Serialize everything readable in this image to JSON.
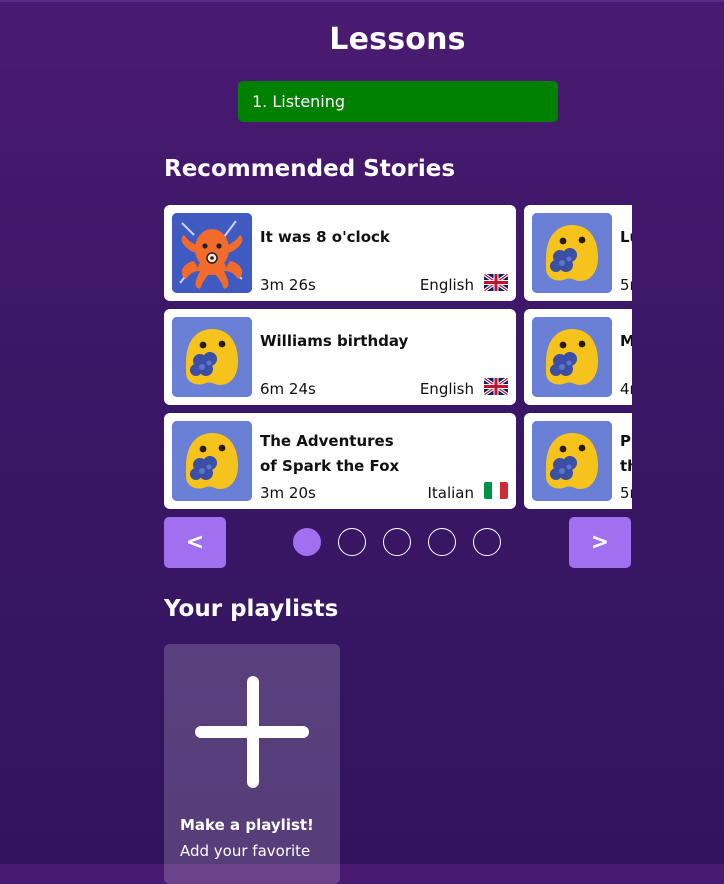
{
  "page": {
    "title": "Lessons"
  },
  "lesson_selector": {
    "label": "1. Listening"
  },
  "recommended": {
    "title": "Recommended Stories",
    "stories": [
      {
        "title": "It was 8 o'clock",
        "duration": "3m 26s",
        "language": "English",
        "flag": "uk-flag-icon",
        "thumbnail": "octopus-image"
      },
      {
        "title": "Lu",
        "duration": "5r",
        "language": "",
        "flag": "",
        "thumbnail": "yellow-blob-with-blueberries-image"
      },
      {
        "title": "Williams birthday",
        "duration": "6m 24s",
        "language": "English",
        "flag": "uk-flag-icon",
        "thumbnail": "yellow-blob-with-blueberries-image"
      },
      {
        "title": "M",
        "duration": "4r",
        "language": "",
        "flag": "",
        "thumbnail": "yellow-blob-with-blueberries-image"
      },
      {
        "title_line1": "The Adventures",
        "title_line2": "of Spark the Fox",
        "duration": "3m 20s",
        "language": "Italian",
        "flag": "italy-flag-icon",
        "thumbnail": "yellow-blob-with-blueberries-image"
      },
      {
        "title_line1": "Pi",
        "title_line2": "th",
        "duration": "5r",
        "language": "",
        "flag": "",
        "thumbnail": "yellow-blob-with-blueberries-image"
      }
    ],
    "pager": {
      "prev_label": "<",
      "next_label": ">",
      "page_count": 5,
      "active_page": 1
    }
  },
  "playlists": {
    "title": "Your playlists",
    "create_card": {
      "heading": "Make a playlist!",
      "subtext": "Add your favorite"
    }
  },
  "colors": {
    "background": "#3b1766",
    "lesson_bar": "#008000",
    "accent": "#a070f0"
  }
}
